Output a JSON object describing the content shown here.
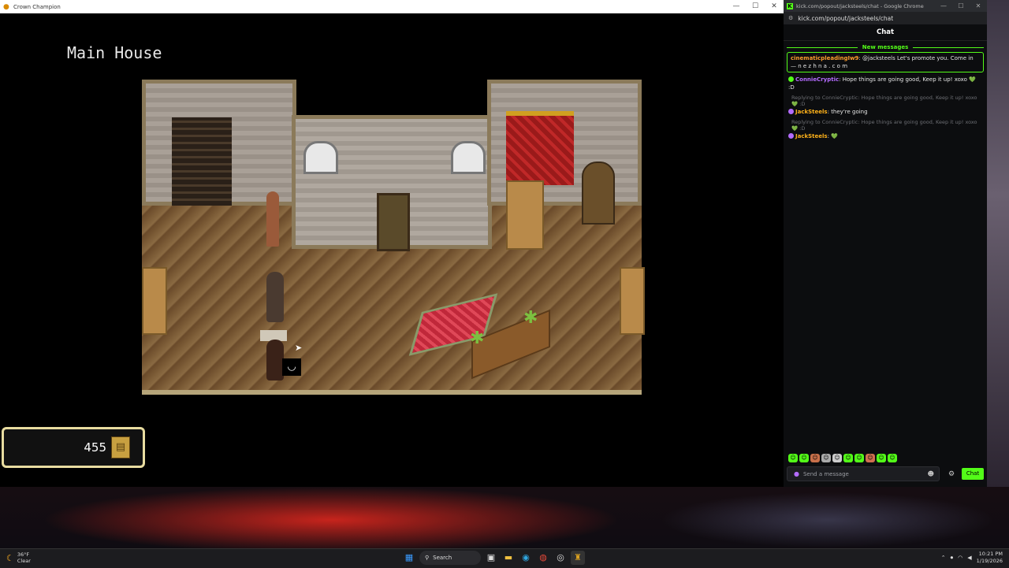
{
  "game_window": {
    "title": "Crown Champion",
    "location_title": "Main House",
    "gold": "455",
    "controls": {
      "minimize": "—",
      "maximize": "☐",
      "close": "✕"
    }
  },
  "chat_window": {
    "chrome_title": "kick.com/popout/jacksteels/chat - Google Chrome",
    "url": "kick.com/popout/jacksteels/chat",
    "header": "Chat",
    "new_messages_label": "New messages",
    "messages": [
      {
        "user": "cinematicpleadingIw9",
        "text": "@jacksteels Let's promote you. Come in — n e z h n a . c o m"
      },
      {
        "user": "ConnieCryptic",
        "text": "Hope things are going good, Keep it up! xoxo 💚 :D"
      },
      {
        "reply": "Replying to ConnieCryptic: Hope things are going good, Keep it up! xoxo 💚 :D",
        "user": "JackSteels",
        "text": "they're going"
      },
      {
        "reply": "Replying to ConnieCryptic: Hope things are going good, Keep it up! xoxo 💚 :D",
        "user": "JackSteels",
        "text": "💚"
      }
    ],
    "input_placeholder": "Send a message",
    "send_label": "Chat",
    "accent_color": "#53fc18"
  },
  "taskbar": {
    "weather_temp": "36°F",
    "weather_cond": "Clear",
    "search_label": "Search",
    "time": "10:21 PM",
    "date": "1/19/2026"
  }
}
